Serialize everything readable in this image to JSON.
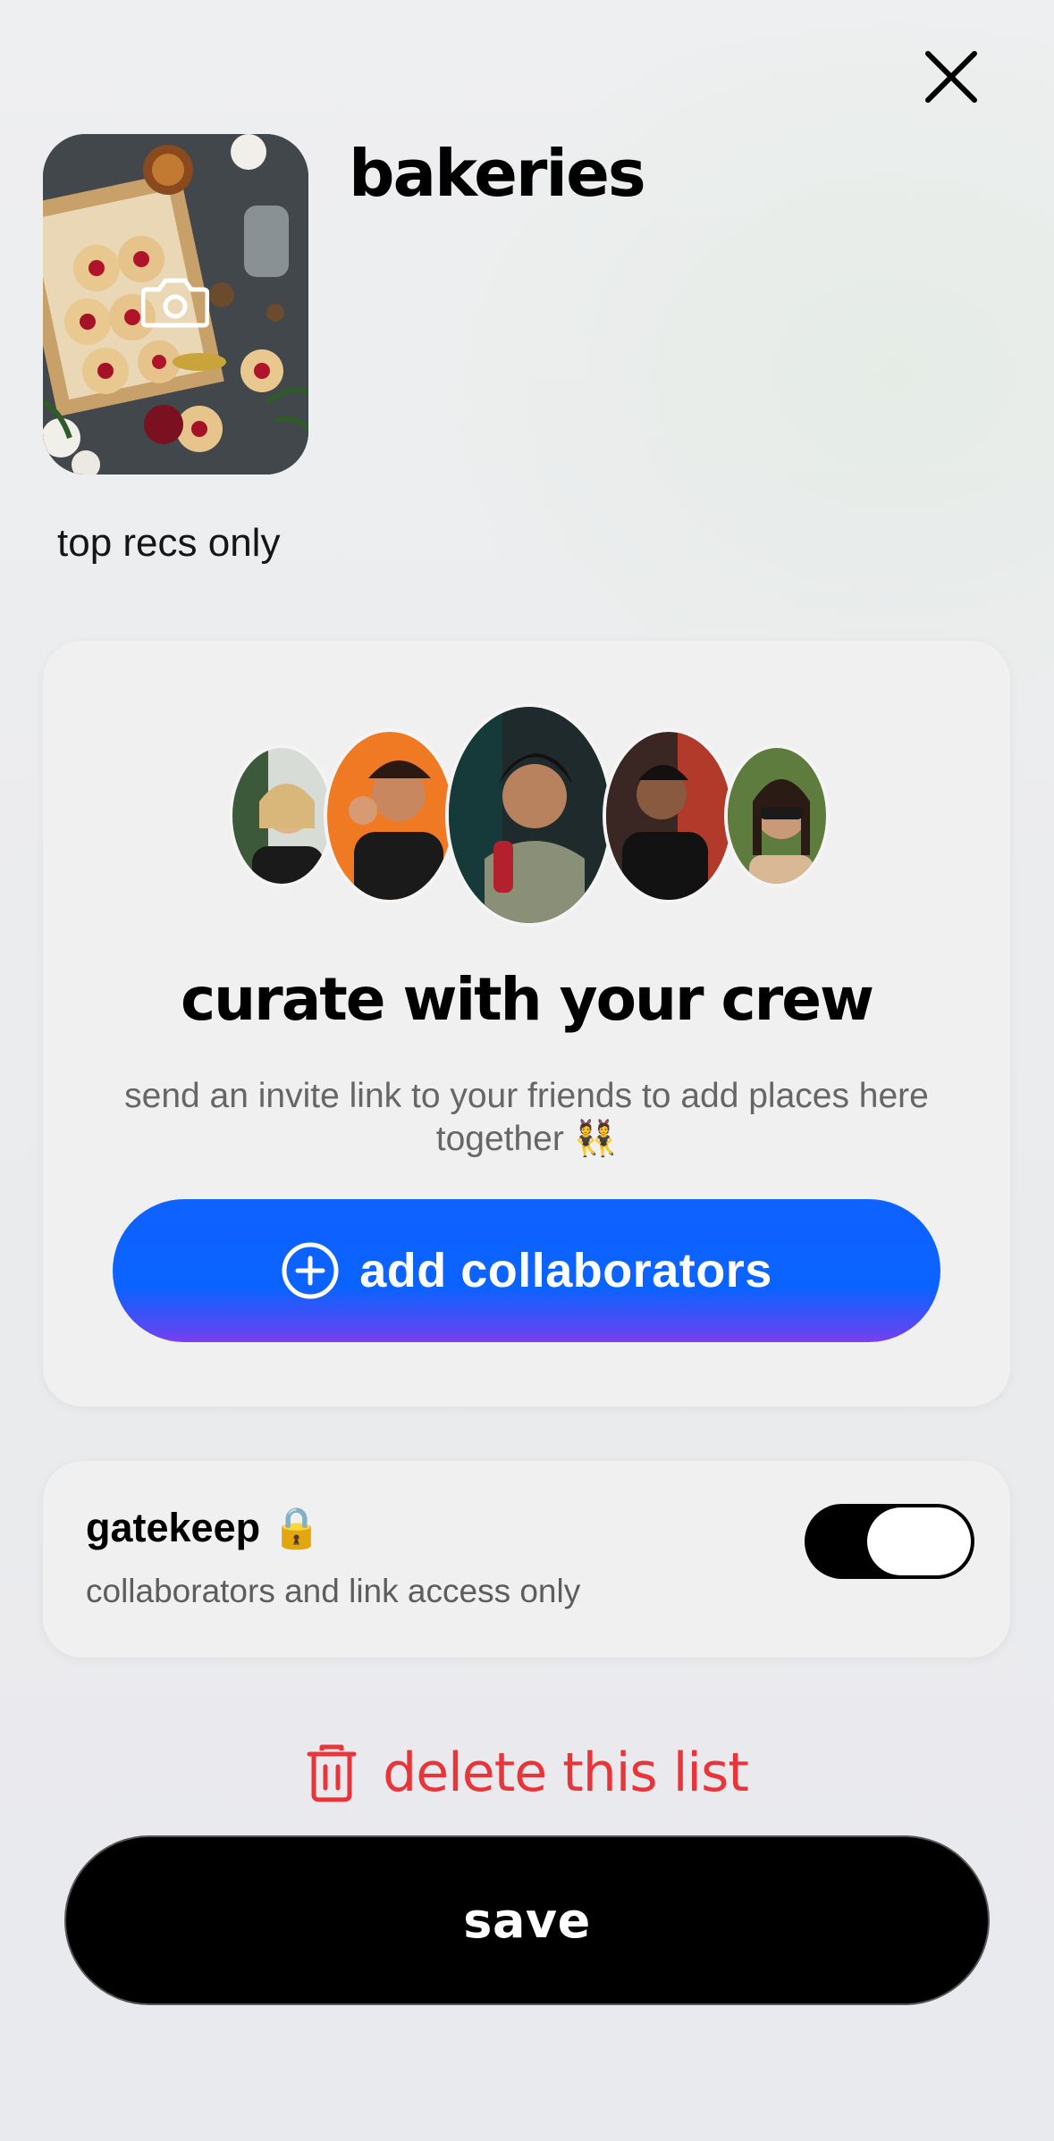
{
  "header": {
    "close_icon": "close-icon"
  },
  "list": {
    "title": "bakeries",
    "description": "top recs only",
    "cover_edit_icon": "camera-icon"
  },
  "crew_card": {
    "title": "curate with your crew",
    "subtitle": "send an invite link to your friends to add places here together 👯",
    "add_button_label": "add collaborators",
    "add_button_icon": "plus-circle-icon"
  },
  "gatekeep": {
    "title": "gatekeep 🔒",
    "subtitle": "collaborators and link access only",
    "enabled": true
  },
  "delete_label": "delete this list",
  "delete_icon": "trash-icon",
  "save_label": "save",
  "colors": {
    "accent_blue": "#0b63ff",
    "accent_purple": "#7c3ff0",
    "danger": "#e8353a"
  }
}
